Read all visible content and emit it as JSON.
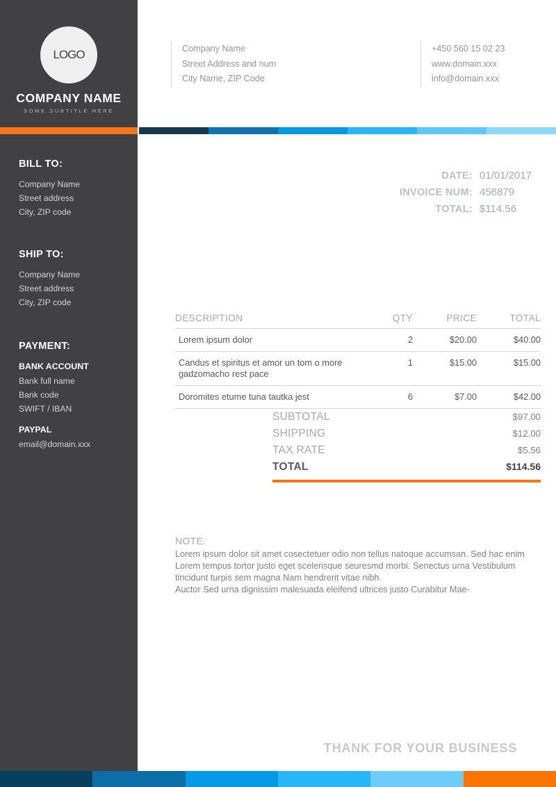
{
  "brand": {
    "logo_text": "LOGO",
    "company_name": "COMPANY NAME",
    "subtitle": "SOME SUBTITLE HERE",
    "accent_orange": "#f6761c",
    "sidebar_dark": "#414042"
  },
  "header": {
    "address_block": {
      "line1": "Company Name",
      "line2": "Street Address and num",
      "line3": "City Name, ZIP Code"
    },
    "contact_block": {
      "line1": "+450 560 15 02 23",
      "line2": "www.domain.xxx",
      "line3": "info@domain.xxx"
    }
  },
  "top_stripes": [
    "#16384e",
    "#0d73b3",
    "#039ae3",
    "#29b6f6",
    "#5ec8f8",
    "#8ed8fb"
  ],
  "sidebar": {
    "bill_to": {
      "heading": "BILL TO:",
      "line1": "Company Name",
      "line2": "Street address",
      "line3": "City, ZIP code"
    },
    "ship_to": {
      "heading": "SHIP TO:",
      "line1": "Company Name",
      "line2": "Street address",
      "line3": "City, ZIP code"
    },
    "payment": {
      "heading": "PAYMENT:",
      "bank_title": "BANK ACCOUNT",
      "bank_line1": "Bank full name",
      "bank_line2": "Bank code",
      "bank_line3": "SWIFT / IBAN",
      "paypal_title": "PAYPAL",
      "paypal_email": "email@domain.xxx"
    }
  },
  "meta": {
    "date_label": "DATE:",
    "date_value": "01/01/2017",
    "invoice_label": "INVOICE NUM:",
    "invoice_value": "456879",
    "total_label": "TOTAL:",
    "total_value": "$114.56"
  },
  "items": {
    "columns": [
      "DESCRIPTION",
      "QTY",
      "PRICE",
      "TOTAL"
    ],
    "rows": [
      {
        "description": "Lorem ipsum dolor",
        "qty": "2",
        "price": "$20.00",
        "total": "$40.00"
      },
      {
        "description": "Candus et spiritus et amor un tom o more gadzomacho rest pace",
        "qty": "1",
        "price": "$15.00",
        "total": "$15.00"
      },
      {
        "description": "Doromites etume tuna tautka jest",
        "qty": "6",
        "price": "$7.00",
        "total": "$42.00"
      }
    ]
  },
  "totals": {
    "subtotal_label": "SUBTOTAL",
    "subtotal_value": "$97.00",
    "shipping_label": "SHIPPING",
    "shipping_value": "$12.00",
    "tax_label": "TAX RATE",
    "tax_value": "$5.56",
    "total_label": "TOTAL",
    "total_value": "$114.56"
  },
  "note": {
    "title": "NOTE:",
    "paragraph1": "Lorem ipsum dolor sit amet cosectetuer odio non tellus natoque accumsan. Sed hac enim Lorem tempus tortor justo eget scelerisque seuresmd morbi. Senectus urna Vestibulum tincidunt turpis sem magna Nam hendrerit vitae nibh.",
    "paragraph2": "Auctor Sed urna dignissim malesuada eleifend ultrices justo Curabitur Mae-"
  },
  "footer": {
    "thanks": "THANK FOR YOUR BUSINESS",
    "bottom_stripes": [
      "#06405e",
      "#0b6ea9",
      "#039ae3",
      "#29b6f6",
      "#6dcdf8",
      "#fa7500"
    ]
  }
}
